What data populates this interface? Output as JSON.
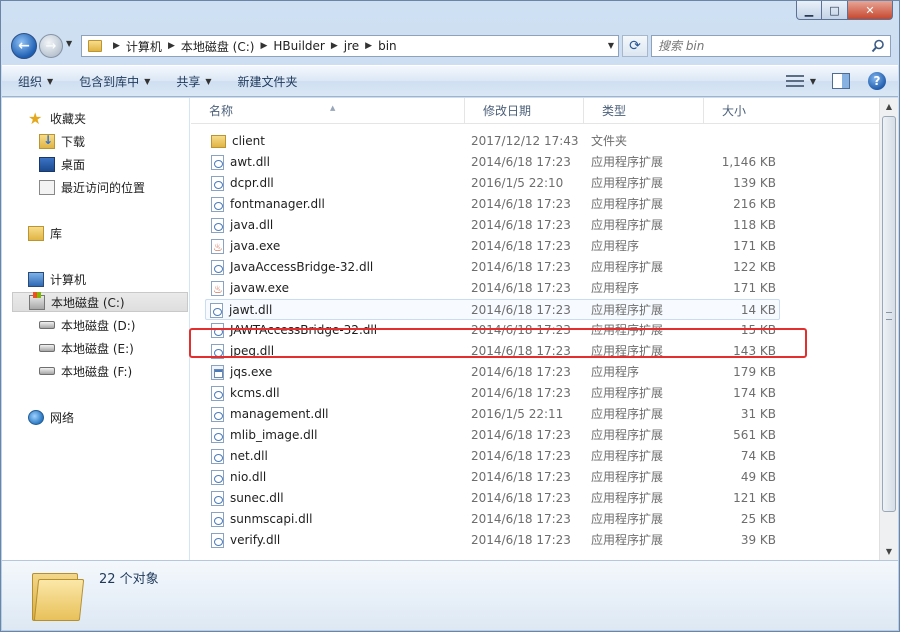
{
  "window": {
    "caption": {
      "minimize": "▁",
      "maximize": "□",
      "close": "✕"
    }
  },
  "address": {
    "breadcrumbs": [
      "计算机",
      "本地磁盘 (C:)",
      "HBuilder",
      "jre",
      "bin"
    ]
  },
  "search": {
    "placeholder": "搜索 bin"
  },
  "toolbar": {
    "organize": "组织",
    "include_in_library": "包含到库中",
    "share": "共享",
    "new_folder": "新建文件夹"
  },
  "nav": {
    "favorites": "收藏夹",
    "downloads": "下载",
    "desktop": "桌面",
    "recent": "最近访问的位置",
    "libraries": "库",
    "computer": "计算机",
    "drive_c": "本地磁盘 (C:)",
    "drive_d": "本地磁盘 (D:)",
    "drive_e": "本地磁盘 (E:)",
    "drive_f": "本地磁盘 (F:)",
    "network": "网络"
  },
  "columns": {
    "name": "名称",
    "date": "修改日期",
    "type": "类型",
    "size": "大小"
  },
  "files": [
    {
      "name": "client",
      "date": "2017/12/12 17:43",
      "type": "文件夹",
      "size": "",
      "icon": "folder"
    },
    {
      "name": "awt.dll",
      "date": "2014/6/18 17:23",
      "type": "应用程序扩展",
      "size": "1,146 KB",
      "icon": "dll"
    },
    {
      "name": "dcpr.dll",
      "date": "2016/1/5 22:10",
      "type": "应用程序扩展",
      "size": "139 KB",
      "icon": "dll"
    },
    {
      "name": "fontmanager.dll",
      "date": "2014/6/18 17:23",
      "type": "应用程序扩展",
      "size": "216 KB",
      "icon": "dll"
    },
    {
      "name": "java.dll",
      "date": "2014/6/18 17:23",
      "type": "应用程序扩展",
      "size": "118 KB",
      "icon": "dll"
    },
    {
      "name": "java.exe",
      "date": "2014/6/18 17:23",
      "type": "应用程序",
      "size": "171 KB",
      "icon": "java"
    },
    {
      "name": "JavaAccessBridge-32.dll",
      "date": "2014/6/18 17:23",
      "type": "应用程序扩展",
      "size": "122 KB",
      "icon": "dll"
    },
    {
      "name": "javaw.exe",
      "date": "2014/6/18 17:23",
      "type": "应用程序",
      "size": "171 KB",
      "icon": "java"
    },
    {
      "name": "jawt.dll",
      "date": "2014/6/18 17:23",
      "type": "应用程序扩展",
      "size": "14 KB",
      "icon": "dll"
    },
    {
      "name": "JAWTAccessBridge-32.dll",
      "date": "2014/6/18 17:23",
      "type": "应用程序扩展",
      "size": "15 KB",
      "icon": "dll"
    },
    {
      "name": "jpeg.dll",
      "date": "2014/6/18 17:23",
      "type": "应用程序扩展",
      "size": "143 KB",
      "icon": "dll"
    },
    {
      "name": "jqs.exe",
      "date": "2014/6/18 17:23",
      "type": "应用程序",
      "size": "179 KB",
      "icon": "exe"
    },
    {
      "name": "kcms.dll",
      "date": "2014/6/18 17:23",
      "type": "应用程序扩展",
      "size": "174 KB",
      "icon": "dll"
    },
    {
      "name": "management.dll",
      "date": "2016/1/5 22:11",
      "type": "应用程序扩展",
      "size": "31 KB",
      "icon": "dll"
    },
    {
      "name": "mlib_image.dll",
      "date": "2014/6/18 17:23",
      "type": "应用程序扩展",
      "size": "561 KB",
      "icon": "dll"
    },
    {
      "name": "net.dll",
      "date": "2014/6/18 17:23",
      "type": "应用程序扩展",
      "size": "74 KB",
      "icon": "dll"
    },
    {
      "name": "nio.dll",
      "date": "2014/6/18 17:23",
      "type": "应用程序扩展",
      "size": "49 KB",
      "icon": "dll"
    },
    {
      "name": "sunec.dll",
      "date": "2014/6/18 17:23",
      "type": "应用程序扩展",
      "size": "121 KB",
      "icon": "dll"
    },
    {
      "name": "sunmscapi.dll",
      "date": "2014/6/18 17:23",
      "type": "应用程序扩展",
      "size": "25 KB",
      "icon": "dll"
    },
    {
      "name": "verify.dll",
      "date": "2014/6/18 17:23",
      "type": "应用程序扩展",
      "size": "39 KB",
      "icon": "dll"
    }
  ],
  "details": {
    "item_count": "22 个对象"
  },
  "colors": {
    "highlight": "#e3302f",
    "accent": "#1e395b"
  }
}
